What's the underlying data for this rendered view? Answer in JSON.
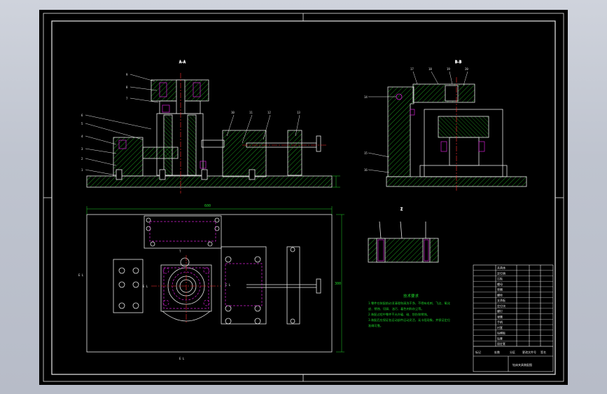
{
  "sheet": {
    "section_labels": [
      "A-A",
      "B-B"
    ],
    "detail_label": "Z",
    "dimension_top": "600",
    "dimension_side": "300",
    "view_marks": [
      "E L",
      "T",
      "E L",
      "C L",
      "E L"
    ]
  },
  "balloons_left": [
    "1",
    "2",
    "3",
    "4",
    "5",
    "6",
    "7",
    "8",
    "9"
  ],
  "balloons_top": [
    "10",
    "11",
    "12",
    "13"
  ],
  "balloons_right": [
    "14",
    "15",
    "16",
    "17",
    "18",
    "19",
    "20"
  ],
  "tech_notes": {
    "title": "技术要求",
    "lines": [
      "1.零件在装配前必须清理和清洗干净，不得有毛刺、飞边、氧化",
      "皮、锈蚀、切屑、油污、着色剂和灰尘等。",
      "2.装配过程中零件不允许磕、碰、划伤和锈蚀。",
      "3.装配后应保证各运动部件运动灵活，无卡阻现象，并保证定位",
      "准确可靠。"
    ]
  },
  "title_block": {
    "rows": [
      "夹具体",
      "定位销",
      "压板",
      "螺母",
      "垫圈",
      "螺栓",
      "支承板",
      "定位块",
      "螺钉",
      "弹簧",
      "手柄",
      "衬套",
      "钻模板",
      "钻套",
      "固定套"
    ],
    "footer": [
      "标记",
      "处数",
      "分区",
      "更改文件号",
      "签名"
    ],
    "name": "钻床夹具装配图"
  },
  "colors": {
    "line": "#e8e8e8",
    "hatch": "#2bd42b",
    "center": "#ff3030",
    "hidden": "#d020d0",
    "dim": "#22d22a"
  }
}
